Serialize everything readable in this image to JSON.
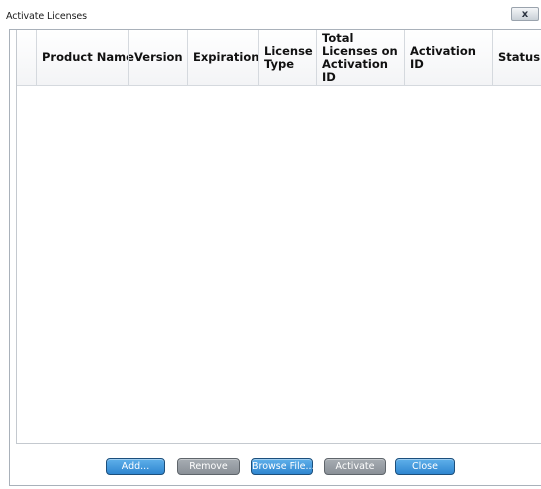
{
  "window": {
    "title": "Activate Licenses",
    "close_label": "x"
  },
  "table": {
    "columns": [
      "Product Name",
      "Version",
      "Expiration",
      "License Type",
      "Total Licenses on Activation ID",
      "Activation ID",
      "Status"
    ],
    "rows": []
  },
  "buttons": {
    "add": "Add...",
    "remove": "Remove",
    "browse": "Browse File...",
    "activate": "Activate",
    "close": "Close"
  }
}
